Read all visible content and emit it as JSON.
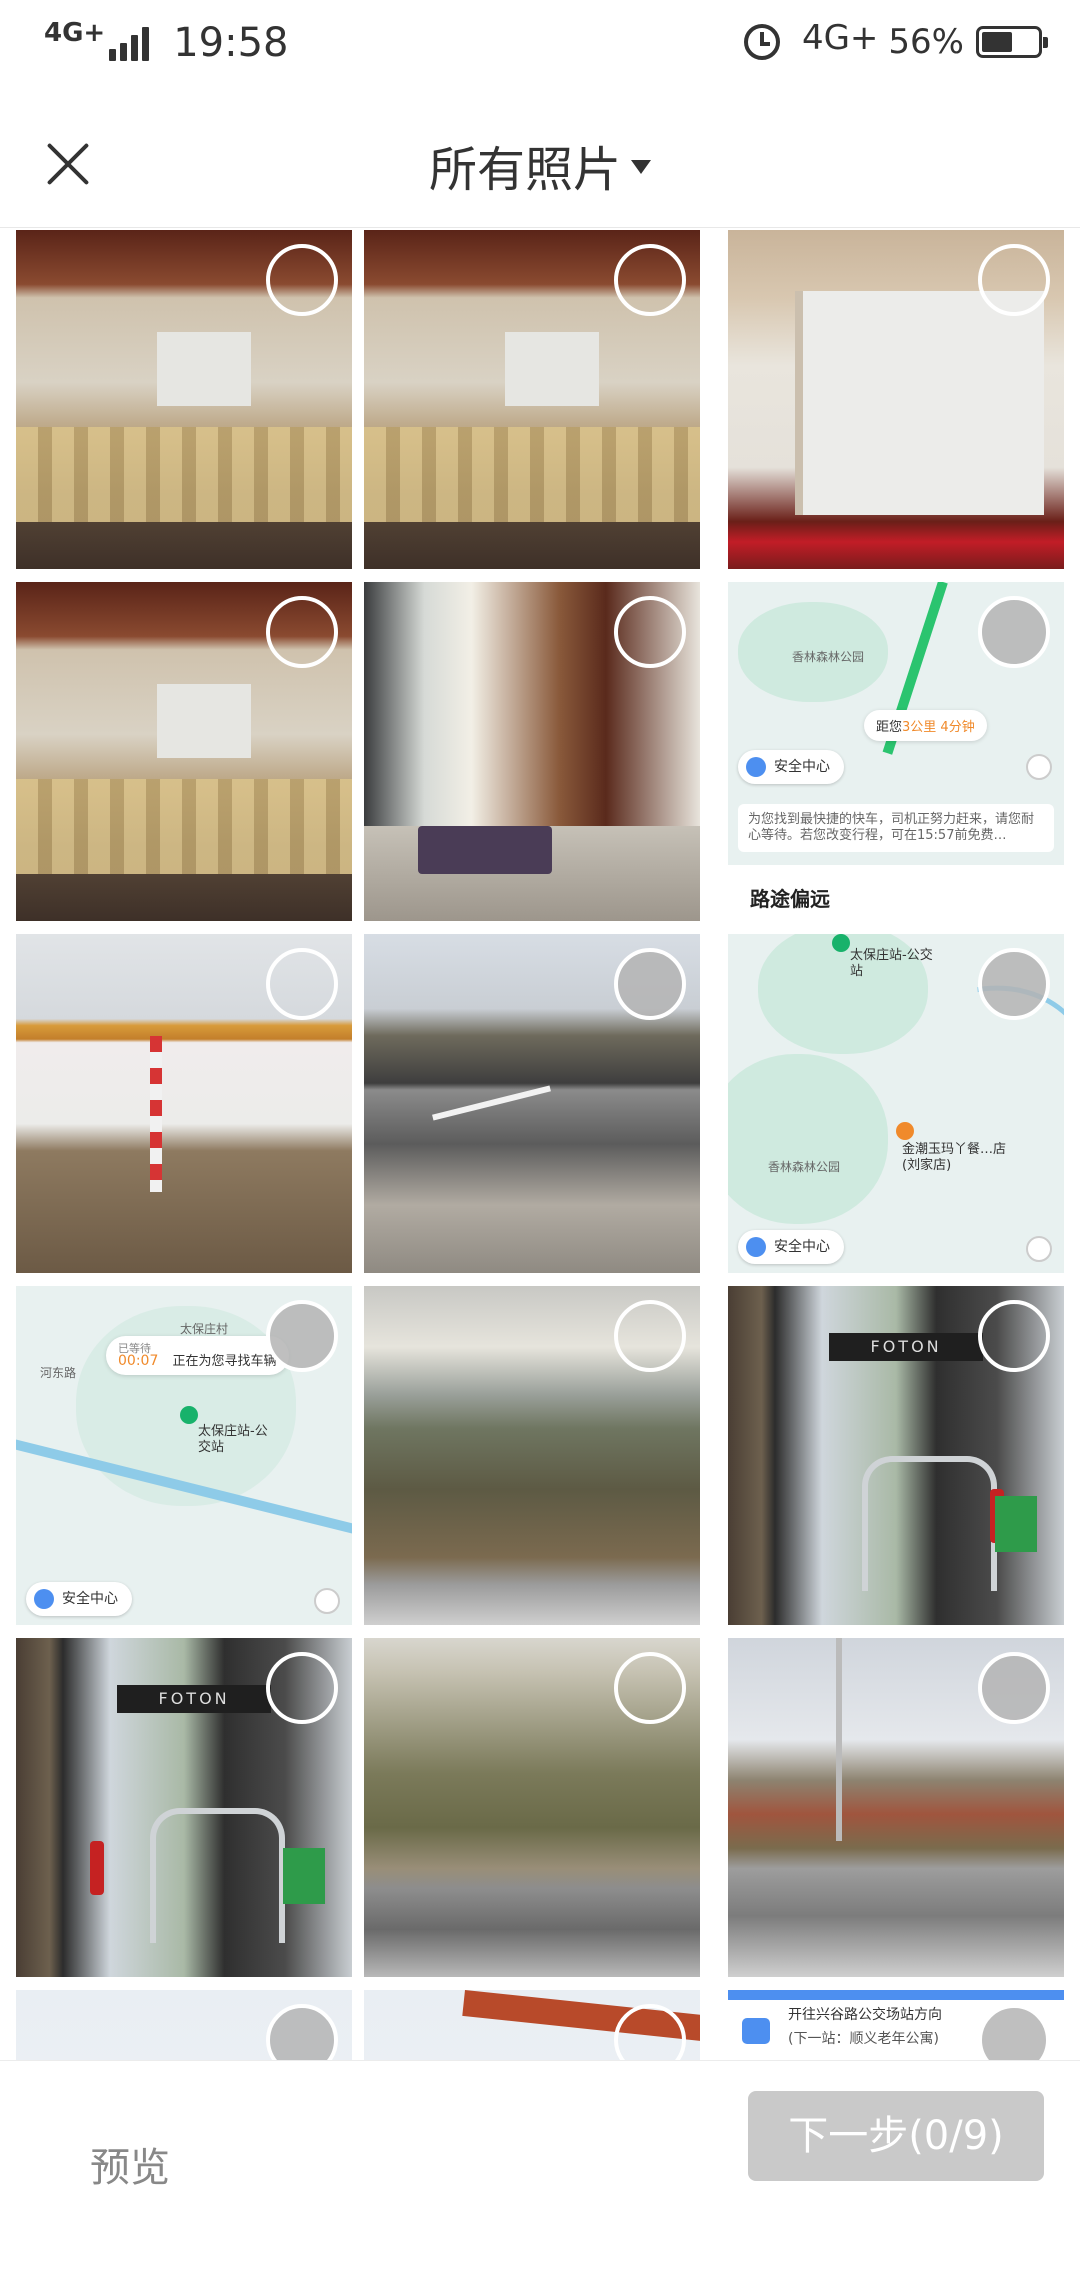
{
  "status_bar": {
    "network_label": "4G+",
    "time": "19:58",
    "network_type": "4G+",
    "battery_percent": "56%",
    "battery_level": 0.56
  },
  "header": {
    "title": "所有照片"
  },
  "map_text": {
    "pill": "安全中心",
    "distance_bubble_prefix": "距您",
    "distance_bubble_highlight": "3公里 4分钟",
    "park_label": "香林森林公园",
    "notice": "为您找到最快捷的快车，司机正努力赶来，请您耐心等待。若您改变行程，可在15:57前免费…",
    "route_bar": "路途偏远",
    "stop1": "太保庄站-公交站",
    "stop2": "金潮玉玛丫餐…店(刘家店)",
    "wait_label": "已等待",
    "wait_time": "00:07",
    "searching": "正在为您寻找车辆",
    "road1": "太保庄村",
    "road2": "河东路"
  },
  "bus_brand": "FOTON",
  "bus_card": {
    "line1": "开往兴谷路公交场站方向",
    "line2": "(下一站：顺义老年公寓)"
  },
  "bottom": {
    "preview_label": "预览",
    "next_label": "下一步(0/9)"
  }
}
